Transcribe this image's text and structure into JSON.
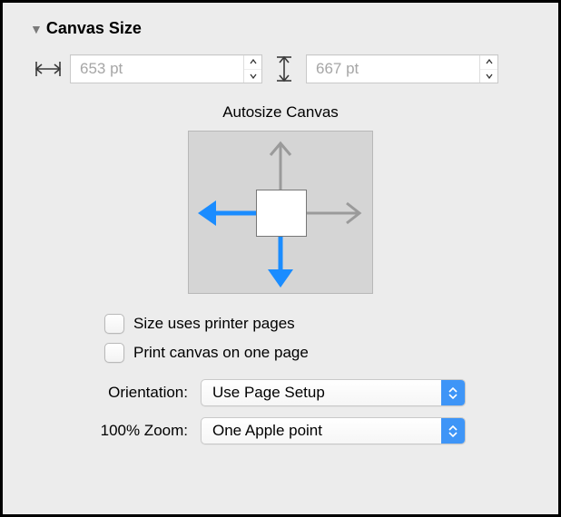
{
  "section": {
    "title": "Canvas Size"
  },
  "width": {
    "value": "653 pt"
  },
  "height": {
    "value": "667 pt"
  },
  "autosize": {
    "label": "Autosize Canvas"
  },
  "checkboxes": {
    "printer_pages": "Size uses printer pages",
    "one_page": "Print canvas on one page"
  },
  "orientation": {
    "label": "Orientation:",
    "value": "Use Page Setup"
  },
  "zoom": {
    "label": "100% Zoom:",
    "value": "One Apple point"
  }
}
